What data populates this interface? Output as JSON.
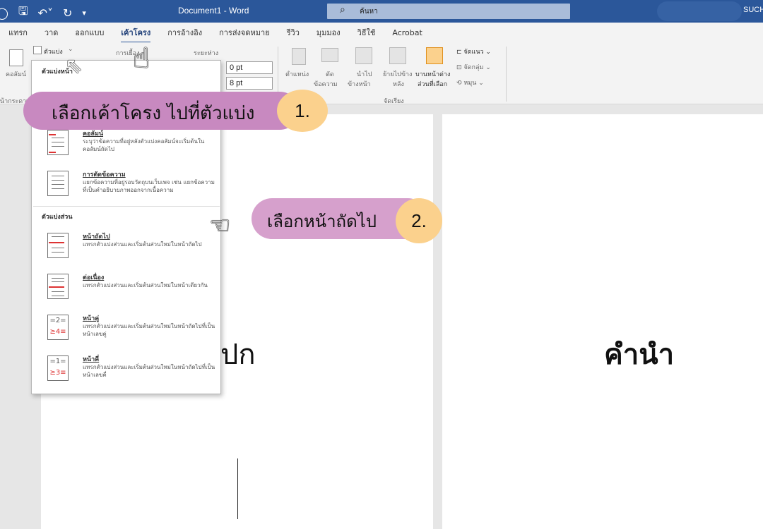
{
  "titlebar": {
    "doc_title": "Document1 - Word",
    "search_placeholder": "ค้นหา",
    "user": "SUCH"
  },
  "tabs": [
    "แทรก",
    "วาด",
    "ออกแบบ",
    "เค้าโครง",
    "การอ้างอิง",
    "การส่งจดหมาย",
    "รีวิว",
    "มุมมอง",
    "วิธีใช้",
    "Acrobat"
  ],
  "ribbon": {
    "columns_label": "คอลัมน์",
    "page_setup_label": "หน้ากระดาษ",
    "breaks_label": "ตัวแบ่ง",
    "indent_label": "การเยื้อง",
    "spacing_label": "ระยะห่าง",
    "spacing_before": "0 pt",
    "spacing_after": "8 pt",
    "position_label": "ตำแหน่ง",
    "wrap_text_label": "ตัด",
    "wrap_text_label2": "ข้อความ",
    "bring_forward_label": "นำไป",
    "bring_forward_label2": "ข้างหน้า",
    "send_backward_label": "ย้ายไปข้าง",
    "send_backward_label2": "หลัง",
    "selection_pane_label": "บานหน้าต่าง",
    "selection_pane_label2": "ส่วนที่เลือก",
    "align_label": "จัดแนว",
    "group_label": "จัดกลุ่ม",
    "rotate_label": "หมุน",
    "arrange_label": "จัดเรียง"
  },
  "dropdown": {
    "page_breaks_header": "ตัวแบ่งหน้า",
    "section_breaks_header": "ตัวแบ่งส่วน",
    "items": [
      {
        "title": "คอลัมน์",
        "desc": "ระบุว่าข้อความที่อยู่หลังตัวแบ่งคอลัมน์จะเริ่มต้นในคอลัมน์ถัดไป"
      },
      {
        "title": "การตัดข้อความ",
        "desc": "แยกข้อความที่อยู่รอบวัตถุบนเว็บเพจ เช่น แยกข้อความที่เป็นคำอธิบายภาพออกจากเนื้อความ"
      },
      {
        "title": "หน้าถัดไป",
        "desc": "แทรกตัวแบ่งส่วนและเริ่มต้นส่วนใหม่ในหน้าถัดไป"
      },
      {
        "title": "ต่อเนื่อง",
        "desc": "แทรกตัวแบ่งส่วนและเริ่มต้นส่วนใหม่ในหน้าเดียวกัน"
      },
      {
        "title": "หน้าคู่",
        "desc": "แทรกตัวแบ่งส่วนและเริ่มต้นส่วนใหม่ในหน้าถัดไปที่เป็นหน้าเลขคู่"
      },
      {
        "title": "หน้าคี่",
        "desc": "แทรกตัวแบ่งส่วนและเริ่มต้นส่วนใหม่ในหน้าถัดไปที่เป็นหน้าเลขคี่"
      }
    ]
  },
  "callouts": {
    "step1_text": "เลือกเค้าโครง ไปที่ตัวแบ่ง",
    "step1_num": "1.",
    "step2_text": "เลือกหน้าถัดไป",
    "step2_num": "2."
  },
  "document": {
    "cover_text": "ปก",
    "intro_text": "คำนำ"
  },
  "colors": {
    "word_blue": "#2b579a",
    "callout_purple": "#c889c0",
    "number_orange": "#fbd18d"
  }
}
